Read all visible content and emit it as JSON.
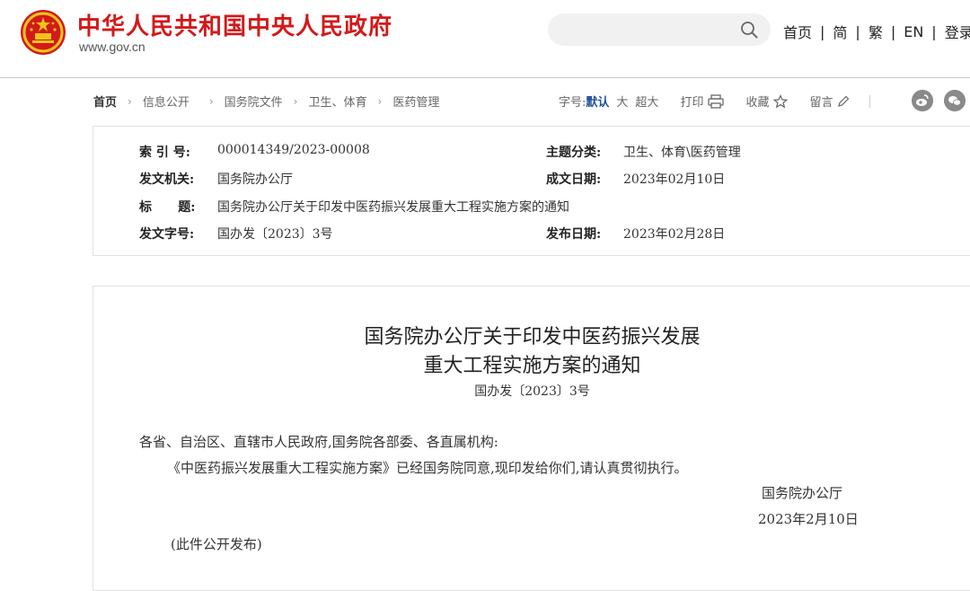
{
  "header": {
    "site_title": "中华人民共和国中央人民政府",
    "site_url": "www.gov.cn",
    "search_placeholder": "",
    "nav": [
      "首页",
      "简",
      "繁",
      "EN",
      "登录"
    ]
  },
  "breadcrumb": [
    "首页",
    "信息公开",
    "国务院文件",
    "卫生、体育",
    "医药管理"
  ],
  "tools": {
    "font_label": "字号:",
    "font_default": "默认",
    "font_large": "大",
    "font_xlarge": "超大",
    "print": "打印",
    "favorite": "收藏",
    "comment": "留言"
  },
  "meta": {
    "index_label": "索 引 号:",
    "index_value": "000014349/2023-00008",
    "category_label": "主题分类:",
    "category_value": "卫生、体育\\医药管理",
    "issuer_label": "发文机关:",
    "issuer_value": "国务院办公厅",
    "created_label": "成文日期:",
    "created_value": "2023年02月10日",
    "title_label": "标      题:",
    "title_value": "国务院办公厅关于印发中医药振兴发展重大工程实施方案的通知",
    "docno_label": "发文字号:",
    "docno_value": "国办发〔2023〕3号",
    "published_label": "发布日期:",
    "published_value": "2023年02月28日"
  },
  "document": {
    "title_line1": "国务院办公厅关于印发中医药振兴发展",
    "title_line2": "重大工程实施方案的通知",
    "doc_number": "国办发〔2023〕3号",
    "salutation": "各省、自治区、直辖市人民政府,国务院各部委、各直属机构:",
    "body": "《中医药振兴发展重大工程实施方案》已经国务院同意,现印发给你们,请认真贯彻执行。",
    "signature": "国务院办公厅",
    "sign_date": "2023年2月10日",
    "note": "(此件公开发布)"
  },
  "colors": {
    "brand_red": "#d21a1a",
    "emblem_gold": "#f0c419",
    "active_font": "#1a4f97"
  },
  "icons": [
    "emblem-icon",
    "search-icon",
    "print-icon",
    "star-icon",
    "pencil-icon",
    "weibo-icon",
    "wechat-icon"
  ]
}
